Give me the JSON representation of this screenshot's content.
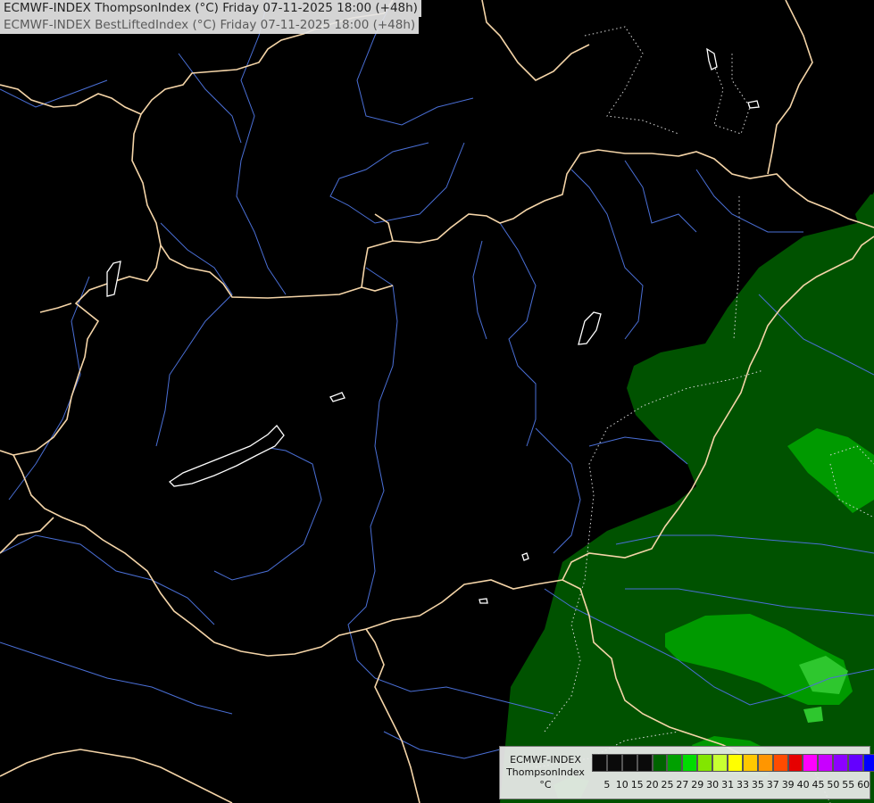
{
  "header": {
    "line1": "ECMWF-INDEX ThompsonIndex (°C) Friday 07-11-2025 18:00 (+48h)",
    "line2": "ECMWF-INDEX BestLiftedIndex (°C) Friday 07-11-2025 18:00 (+48h)"
  },
  "legend": {
    "model": "ECMWF-INDEX",
    "parameter": "ThompsonIndex",
    "unit": "°C",
    "ticks": [
      "5",
      "10",
      "15",
      "20",
      "25",
      "27",
      "29",
      "30",
      "31",
      "33",
      "35",
      "37",
      "39",
      "40",
      "45",
      "50",
      "55",
      "60"
    ],
    "colors": [
      "#0a0a0a",
      "#0a0a0a",
      "#0a0a0a",
      "#0a0a0a",
      "#006400",
      "#00a000",
      "#00dc00",
      "#82e600",
      "#c8ff32",
      "#ffff00",
      "#ffc800",
      "#ff9600",
      "#ff4b00",
      "#e60000",
      "#ff00ff",
      "#c800ff",
      "#8c00ff",
      "#6400ff",
      "#0000ff"
    ]
  },
  "map_colors": {
    "background": "#000000",
    "field_dark": "#005200",
    "field_mid": "#009a00",
    "field_light": "#2ec72e",
    "borders": "#f5d5a8",
    "rivers": "#4a6fd6",
    "lakes": "#ffffff"
  }
}
